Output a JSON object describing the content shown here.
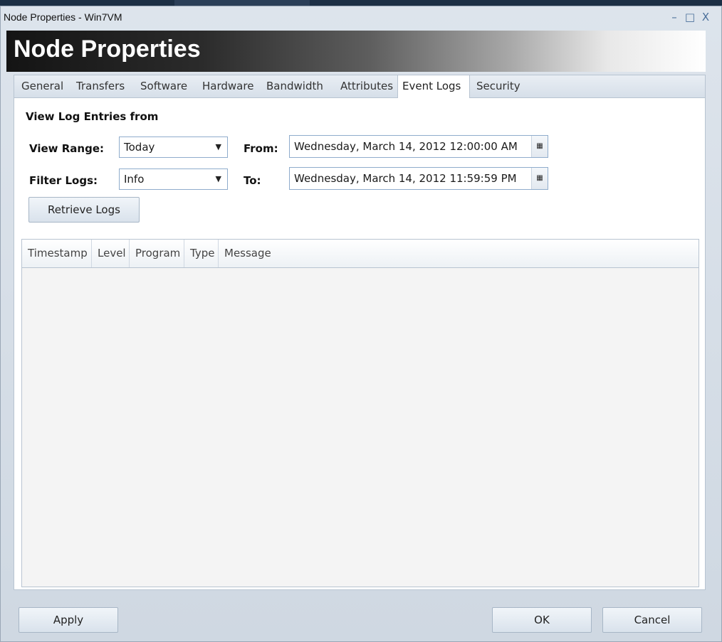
{
  "window": {
    "title": "Node Properties - Win7VM",
    "controls": {
      "minimize": "–",
      "maximize": "□",
      "close": "X"
    }
  },
  "banner": {
    "title": "Node Properties"
  },
  "tabs": [
    "General",
    "Transfers",
    "Software",
    "Hardware",
    "Bandwidth",
    "Attributes",
    "Event Logs",
    "Security"
  ],
  "active_tab": "Event Logs",
  "event_logs": {
    "section_title": "View Log Entries from",
    "view_range_label": "View Range:",
    "view_range_value": "Today",
    "filter_logs_label": "Filter Logs:",
    "filter_logs_value": "Info",
    "from_label": "From:",
    "from_value": "Wednesday, March 14, 2012 12:00:00 AM",
    "to_label": "To:",
    "to_value": "Wednesday, March 14, 2012 11:59:59 PM",
    "retrieve_label": "Retrieve Logs",
    "columns": [
      "Timestamp",
      "Level",
      "Program",
      "Type",
      "Message"
    ],
    "rows": []
  },
  "footer": {
    "apply": "Apply",
    "ok": "OK",
    "cancel": "Cancel"
  },
  "icons": {
    "dropdown_arrow": "▼",
    "calendar": "▦"
  }
}
